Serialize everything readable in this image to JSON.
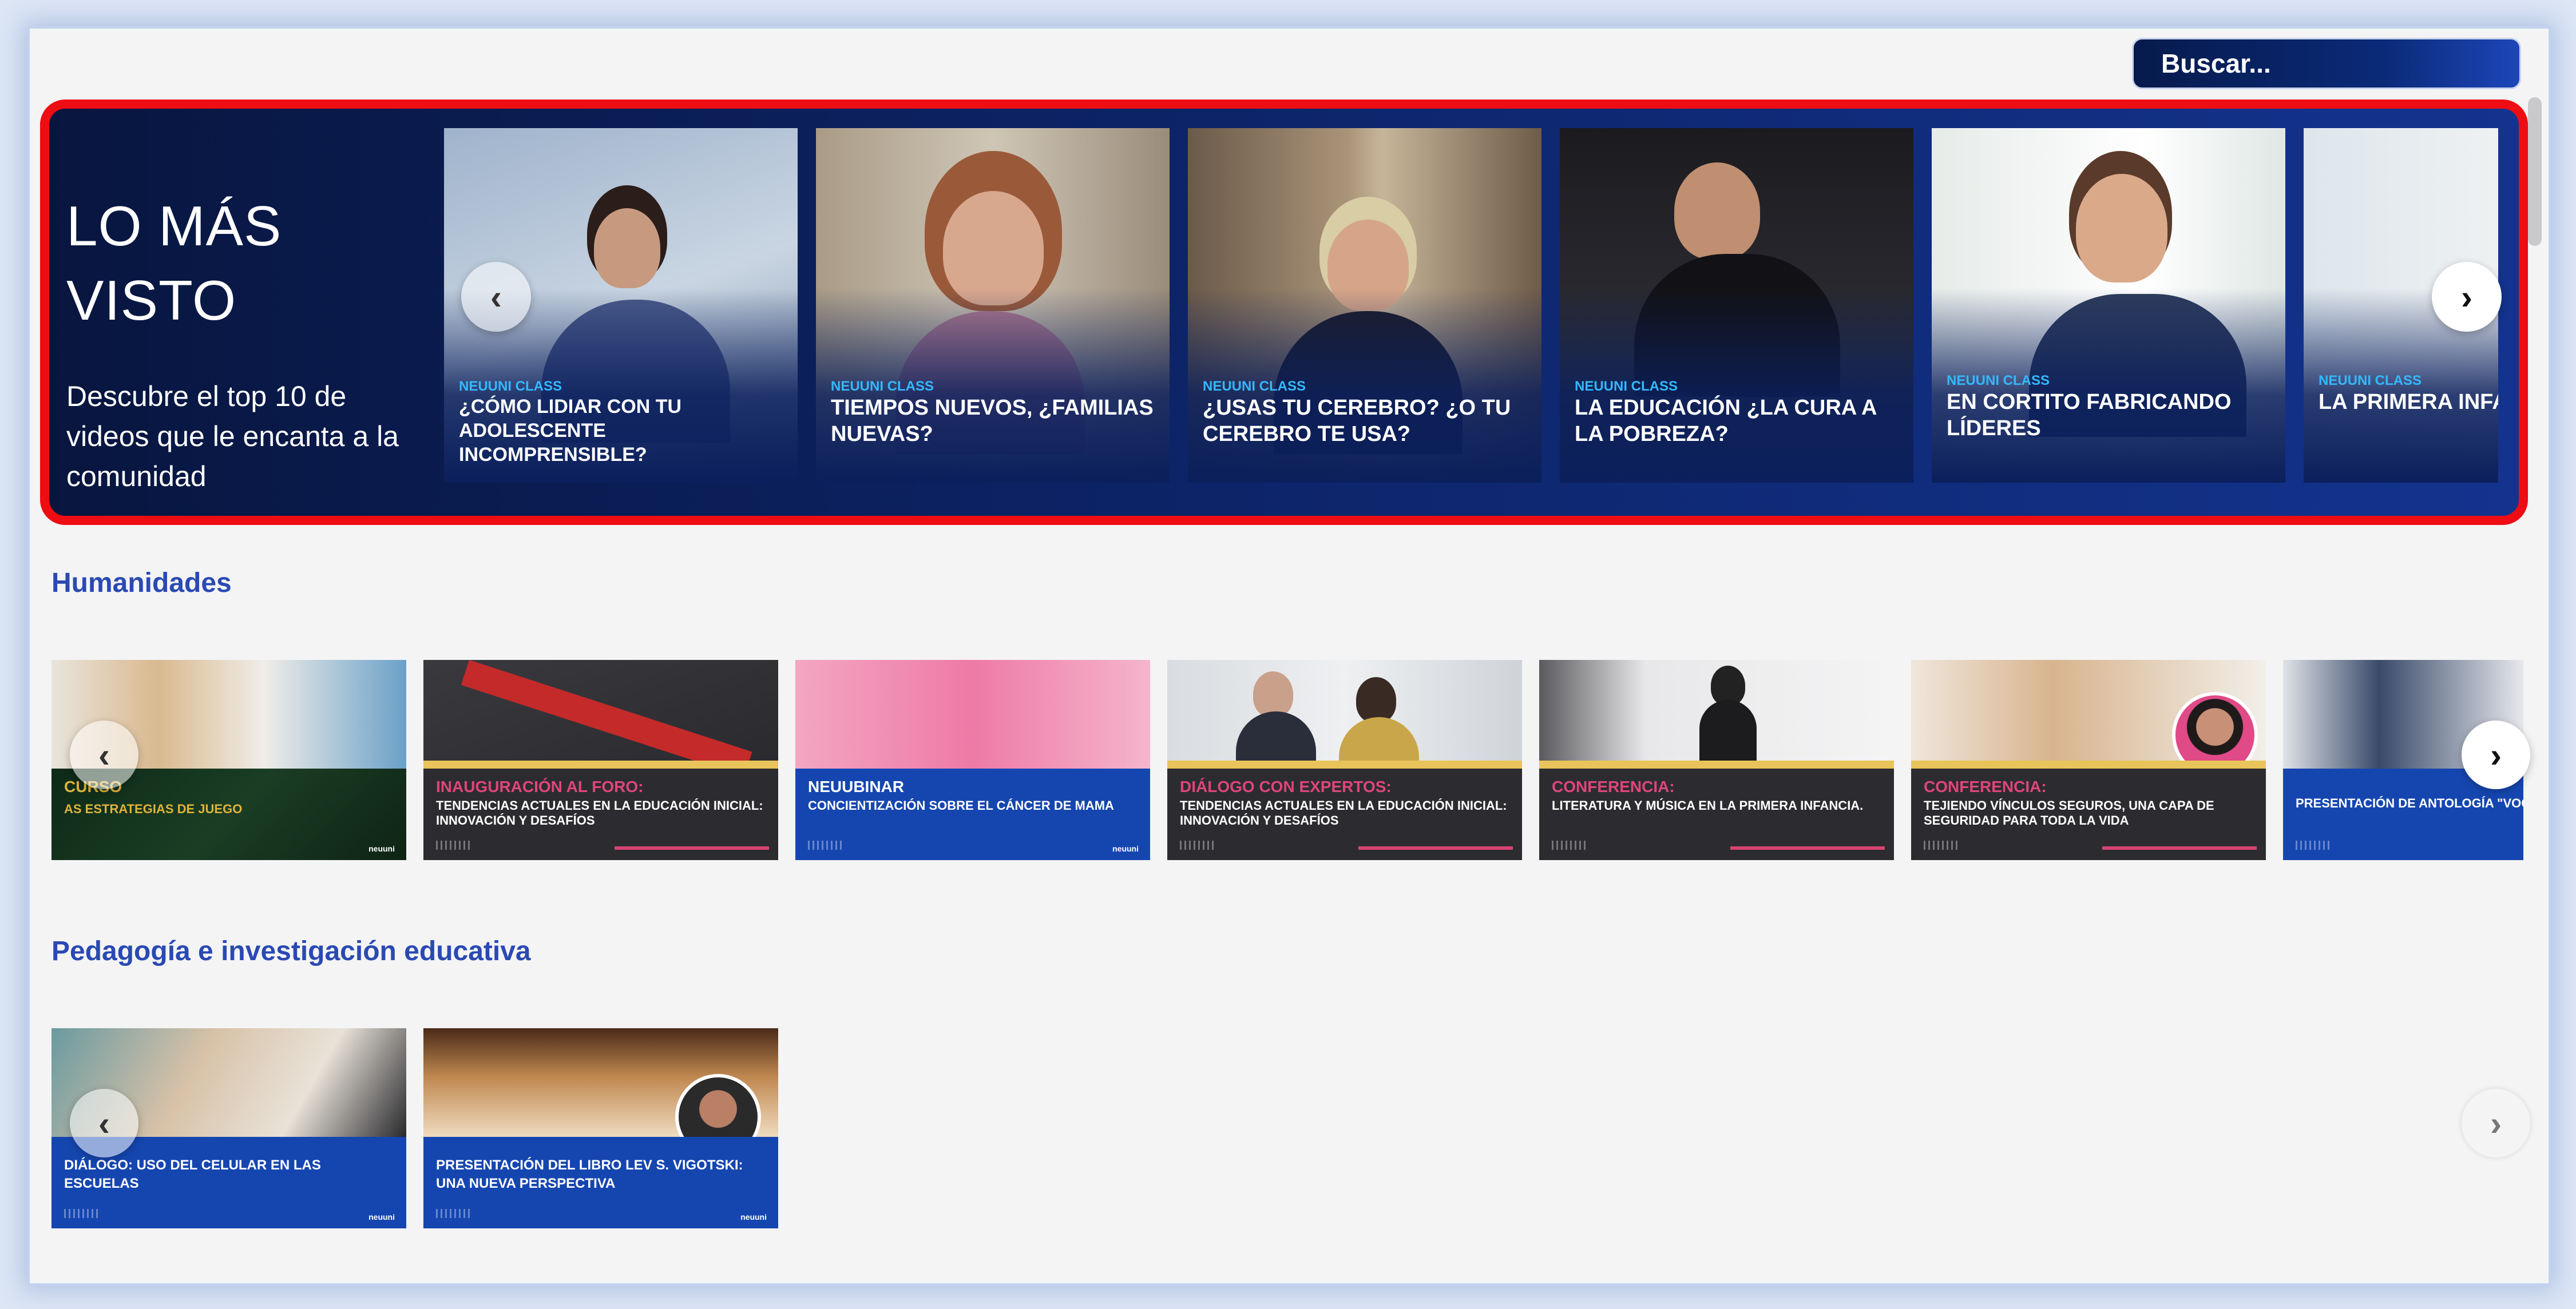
{
  "search": {
    "placeholder": "Buscar..."
  },
  "hero": {
    "title_line1": "LO MÁS",
    "title_line2": "VISTO",
    "subtitle": "Descubre el top 10 de videos que le encanta a la comunidad",
    "cards": [
      {
        "label": "NEUUNI CLASS",
        "title": "¿CÓMO LIDIAR CON TU ADOLESCENTE INCOMPRENSIBLE?"
      },
      {
        "label": "NEUUNI CLASS",
        "title": "TIEMPOS NUEVOS, ¿FAMILIAS NUEVAS?"
      },
      {
        "label": "NEUUNI CLASS",
        "title": "¿USAS TU CEREBRO? ¿O TU CEREBRO TE USA?"
      },
      {
        "label": "NEUUNI CLASS",
        "title": "LA EDUCACIÓN ¿LA CURA A LA POBREZA?"
      },
      {
        "label": "NEUUNI CLASS",
        "title": "EN CORTITO FABRICANDO LÍDERES"
      },
      {
        "label": "NEUUNI CLASS",
        "title": "LA PRIMERA INFANCIA"
      }
    ]
  },
  "sections": [
    {
      "title": "Humanidades",
      "cards": [
        {
          "label": "CURSO",
          "subtitle": "AS ESTRATEGIAS DE JUEGO"
        },
        {
          "label": "INAUGURACIÓN AL FORO:",
          "subtitle": "TENDENCIAS ACTUALES EN LA EDUCACIÓN INICIAL: INNOVACIÓN Y DESAFÍOS"
        },
        {
          "label": "NEUUBINAR",
          "subtitle": "CONCIENTIZACIÓN SOBRE EL CÁNCER DE MAMA"
        },
        {
          "label": "DIÁLOGO CON EXPERTOS:",
          "subtitle": "TENDENCIAS ACTUALES EN LA EDUCACIÓN INICIAL: INNOVACIÓN Y DESAFÍOS"
        },
        {
          "label": "CONFERENCIA:",
          "subtitle": "LITERATURA Y MÚSICA EN LA PRIMERA INFANCIA."
        },
        {
          "label": "CONFERENCIA:",
          "subtitle": "TEJIENDO VÍNCULOS SEGUROS, UNA CAPA DE SEGURIDAD PARA TODA LA VIDA"
        },
        {
          "label": "",
          "subtitle": "PRESENTACIÓN DE ANTOLOGÍA \"VOCES RESILIENTES\""
        }
      ]
    },
    {
      "title": "Pedagogía e investigación educativa",
      "cards": [
        {
          "title": "DIÁLOGO: USO DEL CELULAR EN LAS ESCUELAS"
        },
        {
          "title": "PRESENTACIÓN DEL LIBRO LEV S. VIGOTSKI: UNA NUEVA PERSPECTIVA"
        }
      ]
    }
  ],
  "brand": {
    "logo_text": "neuuni"
  },
  "colors": {
    "accent_blue": "#2a49b3",
    "hero_border": "#ee0d12",
    "hero_label": "#34b8ff",
    "pink_label": "#e0457a",
    "gold_label": "#e8c45a"
  },
  "icons": {
    "prev": "chevron-left-icon",
    "next": "chevron-right-icon"
  },
  "arrows": {
    "prev": "‹",
    "next": "›"
  }
}
